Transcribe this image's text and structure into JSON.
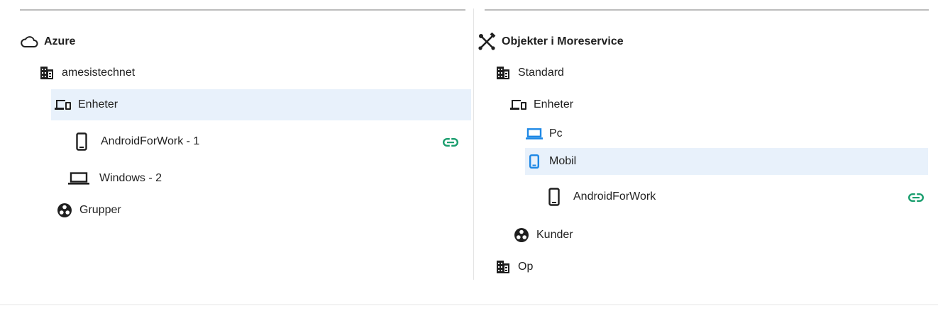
{
  "left_panel": {
    "root": {
      "label": "Azure",
      "icon": "cloud-icon"
    },
    "tenant": {
      "label": "amesistechnet",
      "icon": "building-icon"
    },
    "devices": {
      "label": "Enheter",
      "icon": "devices-icon"
    },
    "items": [
      {
        "label": "AndroidForWork - 1",
        "icon": "phone-icon",
        "linked": true
      },
      {
        "label": "Windows - 2",
        "icon": "laptop-icon",
        "linked": false
      }
    ],
    "groups": {
      "label": "Grupper",
      "icon": "groups-icon"
    }
  },
  "right_panel": {
    "root": {
      "label": "Objekter i Moreservice",
      "icon": "tools-icon"
    },
    "standard": {
      "label": "Standard",
      "icon": "building-icon"
    },
    "devices": {
      "label": "Enheter",
      "icon": "devices-icon"
    },
    "pc": {
      "label": "Pc",
      "icon": "laptop-icon"
    },
    "mobil": {
      "label": "Mobil",
      "icon": "phone-icon"
    },
    "mobil_child": {
      "label": "AndroidForWork",
      "icon": "phone-icon",
      "linked": true
    },
    "customers": {
      "label": "Kunder",
      "icon": "groups-icon"
    },
    "op": {
      "label": "Op",
      "icon": "building-icon"
    }
  },
  "colors": {
    "accent_blue": "#1e88e5",
    "link_green": "#1a9e6e",
    "selection_bg": "#e8f1fb"
  }
}
